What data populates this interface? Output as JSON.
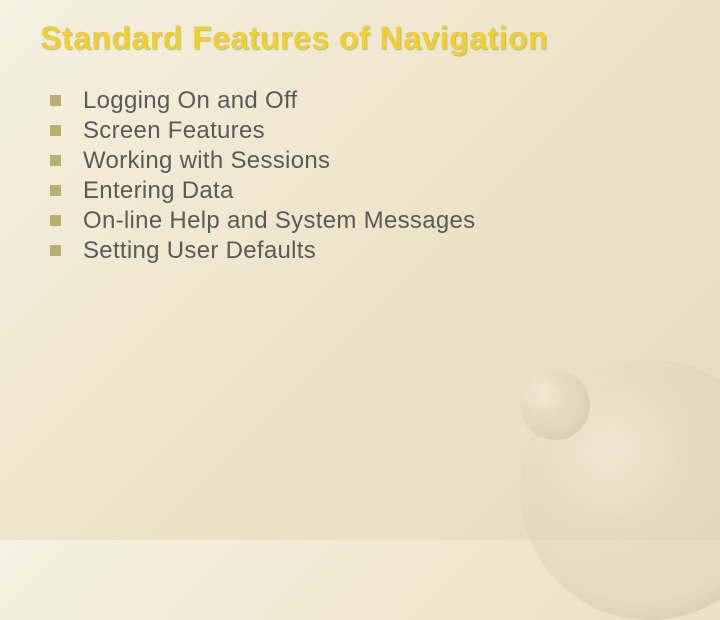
{
  "slide": {
    "title": "Standard Features of Navigation",
    "bullets": [
      "Logging On and Off",
      "Screen Features",
      "Working with Sessions",
      "Entering Data",
      "On-line Help and System Messages",
      "Setting User Defaults"
    ]
  }
}
